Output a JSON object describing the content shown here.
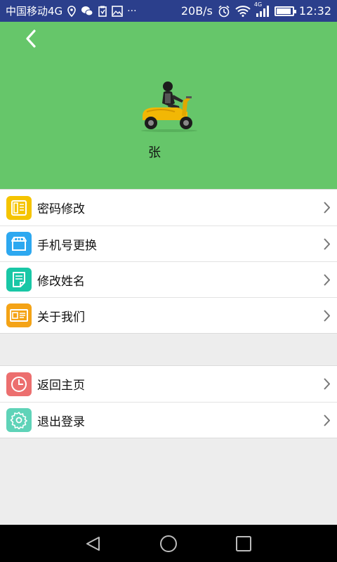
{
  "status_bar": {
    "carrier": "中国移动4G",
    "speed": "20B/s",
    "network_type": "4G",
    "time": "12:32",
    "battery_level": 0.85
  },
  "header": {
    "background": "#66c66a",
    "username": "张"
  },
  "menu_group_1": [
    {
      "label": "密码修改",
      "icon": "document-grid-icon",
      "color": "#f5c400"
    },
    {
      "label": "手机号更换",
      "icon": "store-icon",
      "color": "#2da8f0"
    },
    {
      "label": "修改姓名",
      "icon": "edit-document-icon",
      "color": "#19c7a6"
    },
    {
      "label": "关于我们",
      "icon": "id-card-icon",
      "color": "#f4a316"
    }
  ],
  "menu_group_2": [
    {
      "label": "返回主页",
      "icon": "clock-icon",
      "color": "#ec6f6f"
    },
    {
      "label": "退出登录",
      "icon": "gear-icon",
      "color": "#5fd3b8"
    }
  ]
}
